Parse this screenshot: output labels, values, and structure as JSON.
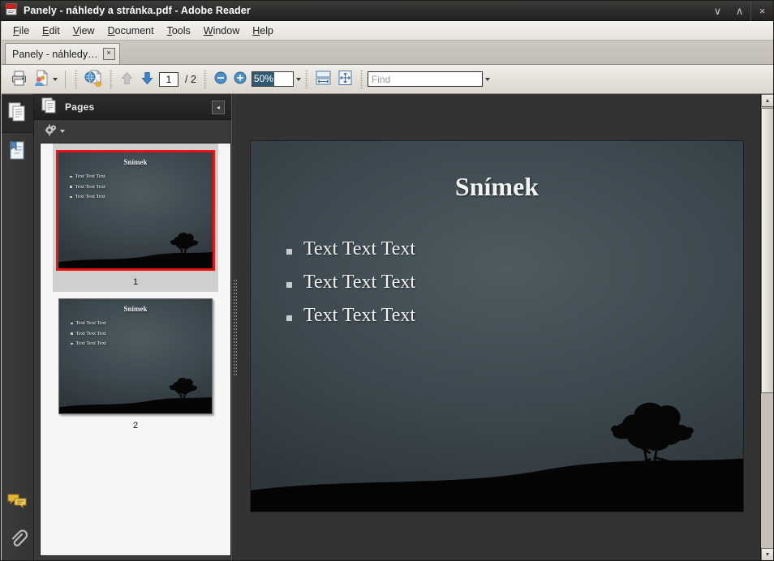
{
  "window": {
    "title": "Panely - náhledy a stránka.pdf - Adobe Reader",
    "app_icon": "pdf-document-icon",
    "controls": {
      "minimize": "∨",
      "maximize": "∧",
      "close": "×"
    }
  },
  "menubar": {
    "items": [
      {
        "label": "File",
        "accel": "F"
      },
      {
        "label": "Edit",
        "accel": "E"
      },
      {
        "label": "View",
        "accel": "V"
      },
      {
        "label": "Document",
        "accel": "D"
      },
      {
        "label": "Tools",
        "accel": "T"
      },
      {
        "label": "Window",
        "accel": "W"
      },
      {
        "label": "Help",
        "accel": "H"
      }
    ]
  },
  "tabbar": {
    "tabs": [
      {
        "label": "Panely - náhledy…",
        "close_label": "×",
        "active": true
      }
    ]
  },
  "toolbar": {
    "print_label": "print-icon",
    "share_label": "share-document-icon",
    "share_caret": "▾",
    "web_label": "attach-to-email-icon",
    "prev_page_label": "previous-page-icon",
    "next_page_label": "next-page-icon",
    "page_current": "1",
    "page_separator": "/ 2",
    "page_total": "2",
    "zoom_out_label": "zoom-out-icon",
    "zoom_in_label": "zoom-in-icon",
    "zoom_value": "50%",
    "zoom_caret": "▾",
    "fit_width_label": "fit-width-icon",
    "fit_page_label": "fit-page-icon",
    "find_value": "",
    "find_placeholder": "Find",
    "find_caret": "▾"
  },
  "rail": {
    "items": [
      {
        "name": "pages-icon",
        "active": true
      },
      {
        "name": "bookmarks-icon",
        "active": false
      }
    ],
    "bottom_items": [
      {
        "name": "comments-icon"
      },
      {
        "name": "attachments-icon"
      }
    ]
  },
  "panel": {
    "title": "Pages",
    "icon": "pages-panel-icon",
    "collapse_label": "◂",
    "options_label": "panel-options-gear-icon",
    "options_caret": "▾"
  },
  "thumbnails": [
    {
      "number": "1",
      "selected": true,
      "title": "Snímek",
      "bullets": [
        "Text Text Text",
        "Text Text Text",
        "Text Text Text"
      ]
    },
    {
      "number": "2",
      "selected": false,
      "title": "Snímek",
      "bullets": [
        "Text Text Text",
        "Text Text Text",
        "Text Text Text"
      ]
    }
  ],
  "document": {
    "slide": {
      "title": "Snímek",
      "bullets": [
        "Text Text Text",
        "Text Text Text",
        "Text Text Text"
      ]
    }
  },
  "scrollbar": {
    "up_label": "▲",
    "down_label": "▼"
  },
  "colors": {
    "titlebar": "#2e2d2b",
    "selection_red": "#ee1111",
    "zoom_highlight": "#2f5a74",
    "slide_dark": "#2f383d",
    "slide_light": "#4e5b61",
    "viewer_bg": "#333333",
    "panel_bg": "#3a3a3a",
    "thumbs_bg": "#f6f6f4"
  }
}
